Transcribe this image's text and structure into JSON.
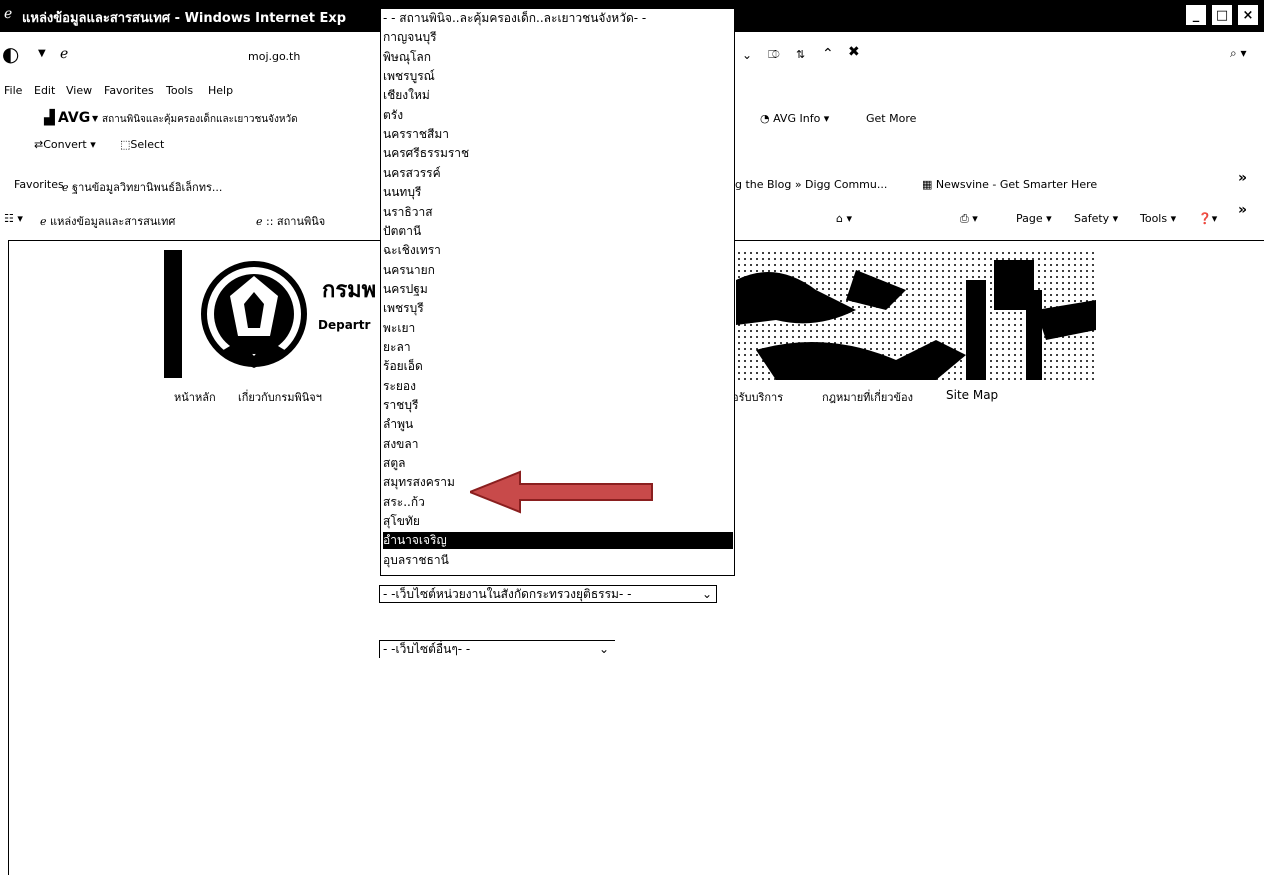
{
  "window": {
    "title": "แหล่งข้อมูลและสารสนเทศ - Windows Internet Exp",
    "minimize": "_",
    "maximize": "□",
    "close": "×"
  },
  "address_bar": {
    "url": "moj.go.th"
  },
  "menu_bar": [
    "File",
    "Edit",
    "View",
    "Favorites",
    "Tools",
    "Help"
  ],
  "avg_toolbar": {
    "brand": "AVG",
    "search_text": "สถานพินิจและคุ้มครองเด็กและเยาวชนจังหวัด",
    "info": "AVG Info",
    "get_more": "Get More"
  },
  "convert_toolbar": {
    "convert": "Convert",
    "select": "Select"
  },
  "favorites_bar": {
    "label": "Favorites",
    "link1": "ฐานข้อมูลวิทยานิพนธ์อิเล็กทร...",
    "link2": "gg the Blog » Digg Commu...",
    "link3": "Newsvine - Get Smarter Here",
    "chevron": "»"
  },
  "tabs_bar": {
    "tab1": "แหล่งข้อมูลและสารสนเทศ",
    "tab2": ":: สถานพินิจ",
    "page": "Page",
    "safety": "Safety",
    "tools": "Tools",
    "chevron": "»"
  },
  "site": {
    "header_title": "กรมพ",
    "header_sub": "Departr",
    "nav": [
      "หน้าหลัก",
      "เกี่ยวกับกรมพินิจฯ",
      "อรับบริการ",
      "กฎหมายที่เกี่ยวข้อง",
      "Site Map"
    ],
    "select2": "- -เว็บไซต์หน่วยงานในสังกัดกระทรวงยุติธรรม- -",
    "select3": "- -เว็บไซต์อื่นๆ- -"
  },
  "dropdown": {
    "items": [
      "- - สถานพินิจ..ละคุ้มครองเด็ก..ละเยาวชนจังหวัด- -",
      "กาญจนบุรี",
      "พิษณุโลก",
      "เพชรบูรณ์",
      "เชียงใหม่",
      "ตรัง",
      "นครราชสีมา",
      "นครศรีธรรมราช",
      "นครสวรรค์",
      "นนทบุรี",
      "นราธิวาส",
      "ปัตตานี",
      "ฉะเชิงเทรา",
      "นครนายก",
      "นครปฐม",
      "เพชรบุรี",
      "พะเยา",
      "ยะลา",
      "ร้อยเอ็ด",
      "ระยอง",
      "ราชบุรี",
      "ลำพูน",
      "สงขลา",
      "สตูล",
      "สมุทรสงคราม",
      "สระ..ก้ว",
      "สุโขทัย",
      "อำนาจเจริญ",
      "อุบลราชธานี"
    ],
    "selected_index": 27
  },
  "colors": {
    "arrow": "#c84a4a",
    "arrow_dark": "#8a1f1f"
  }
}
